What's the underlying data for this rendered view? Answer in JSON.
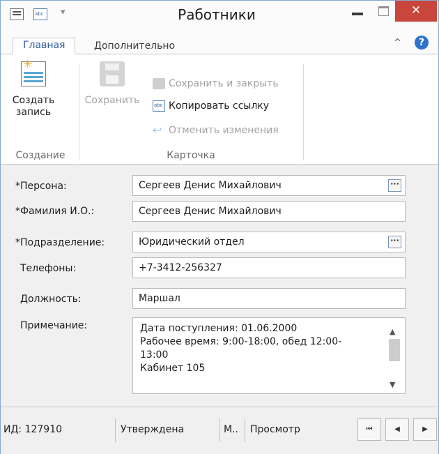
{
  "window": {
    "title": "Работники",
    "close_glyph": "✕"
  },
  "tabs": [
    {
      "label": "Главная"
    },
    {
      "label": "Дополнительно"
    }
  ],
  "ribbon": {
    "create_label_line1": "Создать",
    "create_label_line2": "запись",
    "save_label": "Сохранить",
    "save_close_label": "Сохранить и закрыть",
    "copy_link_label": "Копировать ссылку",
    "undo_label": "Отменить изменения",
    "group_create": "Создание",
    "group_card": "Карточка"
  },
  "form": {
    "person_label": "*Персона:",
    "person_value": "Сергеев Денис Михайлович",
    "short_name_label": "*Фамилия И.О.:",
    "short_name_value": "Сергеев Денис Михайлович",
    "department_label": "*Подразделение:",
    "department_value": "Юридический отдел",
    "phones_label": "Телефоны:",
    "phones_value": "+7-3412-256327",
    "position_label": "Должность:",
    "position_value": "Маршал",
    "note_label": "Примечание:",
    "note_lines": [
      "Дата поступления: 01.06.2000",
      "Рабочее время: 9:00-18:00, обед 12:00-",
      "13:00",
      "Кабинет 105"
    ],
    "ellipsis": "···"
  },
  "status": {
    "id": "ИД: 127910",
    "state": "Утверждена",
    "short": "М..",
    "mode": "Просмотр"
  },
  "icons": {
    "qat_abc": "abc",
    "first_glyph": "⏮",
    "prev_glyph": "◀",
    "next_glyph": "▶"
  }
}
